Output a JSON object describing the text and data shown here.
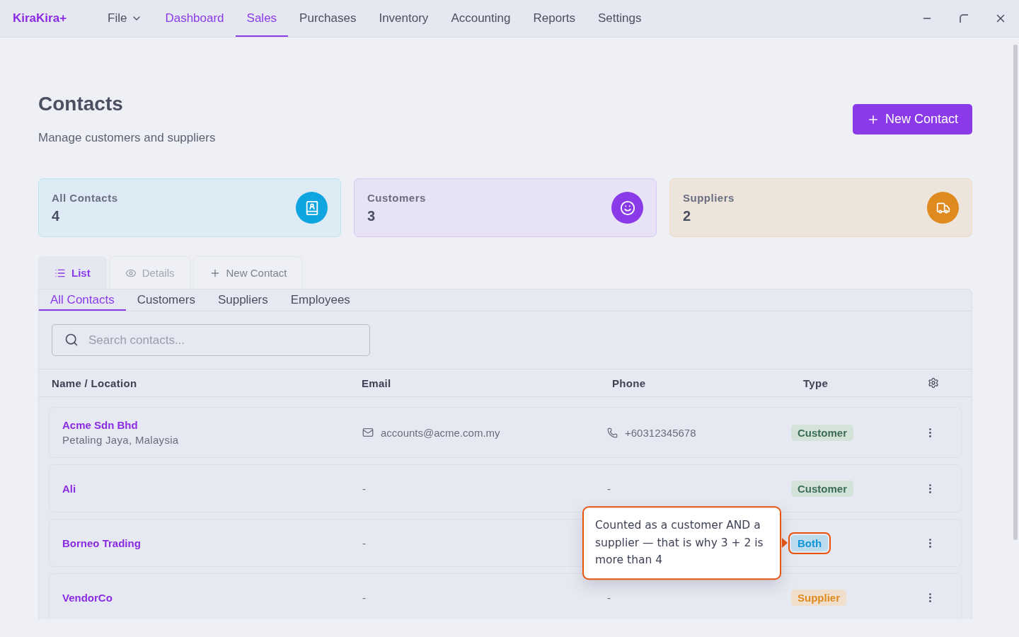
{
  "app": {
    "logo": "KiraKira+",
    "menu": [
      {
        "label": "File",
        "kind": "dropdown",
        "selected": false,
        "highlighted": false
      },
      {
        "label": "Dashboard",
        "kind": "link",
        "selected": false,
        "highlighted": true
      },
      {
        "label": "Sales",
        "kind": "link",
        "selected": true,
        "highlighted": true
      },
      {
        "label": "Purchases",
        "kind": "link",
        "selected": false,
        "highlighted": false
      },
      {
        "label": "Inventory",
        "kind": "link",
        "selected": false,
        "highlighted": false
      },
      {
        "label": "Accounting",
        "kind": "link",
        "selected": false,
        "highlighted": false
      },
      {
        "label": "Reports",
        "kind": "link",
        "selected": false,
        "highlighted": false
      },
      {
        "label": "Settings",
        "kind": "link",
        "selected": false,
        "highlighted": false
      }
    ]
  },
  "page": {
    "title": "Contacts",
    "subtitle": "Manage customers and suppliers",
    "new_button": "New Contact"
  },
  "stats": [
    {
      "kind": "all",
      "label": "All Contacts",
      "value": "4"
    },
    {
      "kind": "customers",
      "label": "Customers",
      "value": "3"
    },
    {
      "kind": "suppliers",
      "label": "Suppliers",
      "value": "2"
    }
  ],
  "view_tabs": [
    {
      "kind": "list",
      "label": "List",
      "selected": true,
      "disabled": false
    },
    {
      "kind": "details",
      "label": "Details",
      "selected": false,
      "disabled": true
    },
    {
      "kind": "new",
      "label": "New Contact",
      "selected": false,
      "disabled": false
    }
  ],
  "filter_tabs": [
    {
      "label": "All Contacts",
      "selected": true
    },
    {
      "label": "Customers",
      "selected": false
    },
    {
      "label": "Suppliers",
      "selected": false
    },
    {
      "label": "Employees",
      "selected": false
    }
  ],
  "search": {
    "placeholder": "Search contacts..."
  },
  "table": {
    "columns": [
      "Name / Location",
      "Email",
      "Phone",
      "Type"
    ],
    "rows": [
      {
        "name": "Acme Sdn Bhd",
        "location": "Petaling Jaya, Malaysia",
        "email": "accounts@acme.com.my",
        "phone": "+60312345678",
        "type": {
          "kind": "customer",
          "label": "Customer"
        },
        "highlighted": false
      },
      {
        "name": "Ali",
        "email": "-",
        "phone": "-",
        "type": {
          "kind": "customer",
          "label": "Customer"
        },
        "highlighted": false
      },
      {
        "name": "Borneo Trading",
        "email": "-",
        "type": {
          "kind": "both",
          "label": "Both"
        },
        "highlighted": true,
        "callout": "Counted as a customer AND a supplier — that is why 3 + 2 is more than 4"
      },
      {
        "name": "VendorCo",
        "email": "-",
        "phone": "-",
        "type": {
          "kind": "supplier",
          "label": "Supplier"
        },
        "highlighted": false
      }
    ]
  }
}
